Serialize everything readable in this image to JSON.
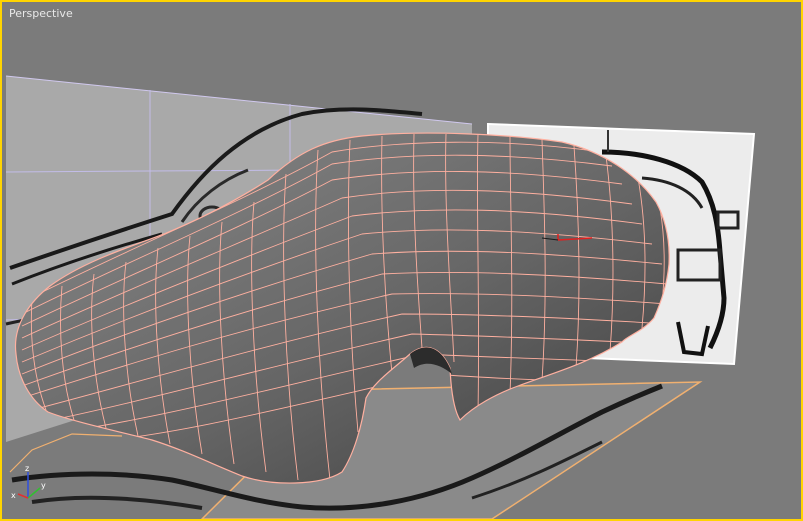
{
  "viewport": {
    "label": "Perspective",
    "active_border_color": "#ffd400",
    "background_color": "#7b7b7b"
  },
  "scene": {
    "wireframe_color": "#ffb0a0",
    "model_surface_color": "#6b6b6b",
    "side_blueprint_plane_color": "#a9a9a9",
    "front_blueprint_plane_color": "#ececec",
    "ground_plane_border_color": "#f0b070",
    "reference_plane_border_color": "#ffffff"
  },
  "axis_gizmo": {
    "x_label": "x",
    "y_label": "y",
    "z_label": "z",
    "x_color": "#e03030",
    "y_color": "#30c030",
    "z_color": "#3050e0"
  }
}
